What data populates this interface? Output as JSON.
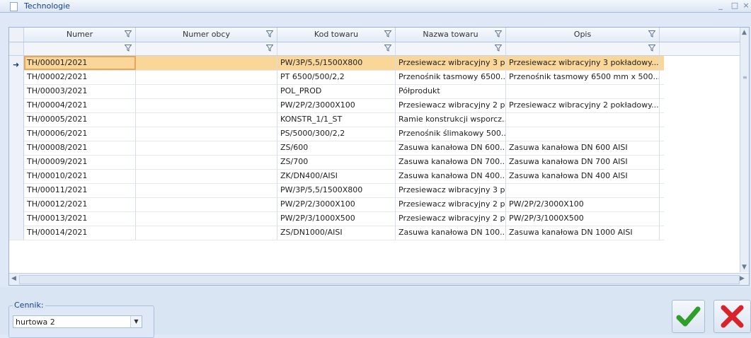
{
  "window": {
    "title": "Technologie"
  },
  "columns": [
    "Numer",
    "Numer obcy",
    "Kod towaru",
    "Nazwa towaru",
    "Opis"
  ],
  "rows": [
    [
      "TH/00001/2021",
      "",
      "PW/3P/5,5/1500X800",
      "Przesiewacz wibracyjny 3 p...",
      "Przesiewacz wibracyjny 3 pokładowy..."
    ],
    [
      "TH/00002/2021",
      "",
      "PT 6500/500/2,2",
      "Przenośnik tasmowy 6500...",
      "Przenośnik tasmowy 6500 mm x 500..."
    ],
    [
      "TH/00003/2021",
      "",
      "POL_PROD",
      "Półprodukt",
      ""
    ],
    [
      "TH/00004/2021",
      "",
      "PW/2P/2/3000X100",
      "Przesiewacz wibracyjny 2 p...",
      "Przesiewacz wibracyjny 2 pokładowy..."
    ],
    [
      "TH/00005/2021",
      "",
      "KONSTR_1/1_ST",
      "Ramie konstrukcji wsporcz...",
      ""
    ],
    [
      "TH/00006/2021",
      "",
      "PS/5000/300/2,2",
      "Przenośnik ślimakowy 500...",
      ""
    ],
    [
      "TH/00008/2021",
      "",
      "ZS/600",
      "Zasuwa kanałowa DN 600...",
      "Zasuwa kanałowa DN 600 AISI"
    ],
    [
      "TH/00009/2021",
      "",
      "ZS/700",
      "Zasuwa kanałowa DN 700...",
      "Zasuwa kanałowa DN 700 AISI"
    ],
    [
      "TH/00010/2021",
      "",
      "ZK/DN400/AISI",
      "Zasuwa kanałowa DN 400...",
      "Zasuwa kanałowa DN 400 AISI"
    ],
    [
      "TH/00011/2021",
      "",
      "PW/3P/5,5/1500X800",
      "Przesiewacz wibracyjny 3 p...",
      ""
    ],
    [
      "TH/00012/2021",
      "",
      "PW/2P/2/3000X100",
      "Przesiewacz wibracyjny 2 p...",
      "PW/2P/2/3000X100"
    ],
    [
      "TH/00013/2021",
      "",
      "PW/2P/3/1000X500",
      "Przesiewacz wibracyjny 2 p...",
      "PW/2P/3/1000X500"
    ],
    [
      "TH/00014/2021",
      "",
      "ZS/DN1000/AISI",
      "Zasuwa kanałowa DN 100...",
      "Zasuwa kanałowa DN 1000 AISI"
    ]
  ],
  "selected_row": 1,
  "cennik": {
    "label": "Cennik:",
    "value": "hurtowa 2"
  },
  "colors": {
    "selection": "#fbd699",
    "accent": "#15428b",
    "ok": "#2f9e2a",
    "cancel": "#d8232a"
  }
}
